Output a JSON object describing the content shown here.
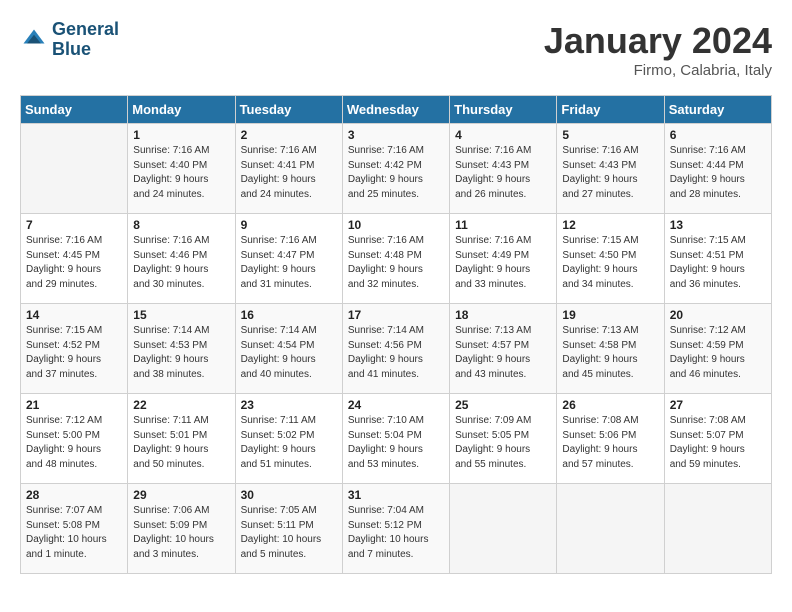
{
  "header": {
    "logo_line1": "General",
    "logo_line2": "Blue",
    "month": "January 2024",
    "location": "Firmo, Calabria, Italy"
  },
  "days_of_week": [
    "Sunday",
    "Monday",
    "Tuesday",
    "Wednesday",
    "Thursday",
    "Friday",
    "Saturday"
  ],
  "weeks": [
    [
      {
        "day": "",
        "info": ""
      },
      {
        "day": "1",
        "info": "Sunrise: 7:16 AM\nSunset: 4:40 PM\nDaylight: 9 hours\nand 24 minutes."
      },
      {
        "day": "2",
        "info": "Sunrise: 7:16 AM\nSunset: 4:41 PM\nDaylight: 9 hours\nand 24 minutes."
      },
      {
        "day": "3",
        "info": "Sunrise: 7:16 AM\nSunset: 4:42 PM\nDaylight: 9 hours\nand 25 minutes."
      },
      {
        "day": "4",
        "info": "Sunrise: 7:16 AM\nSunset: 4:43 PM\nDaylight: 9 hours\nand 26 minutes."
      },
      {
        "day": "5",
        "info": "Sunrise: 7:16 AM\nSunset: 4:43 PM\nDaylight: 9 hours\nand 27 minutes."
      },
      {
        "day": "6",
        "info": "Sunrise: 7:16 AM\nSunset: 4:44 PM\nDaylight: 9 hours\nand 28 minutes."
      }
    ],
    [
      {
        "day": "7",
        "info": "Sunrise: 7:16 AM\nSunset: 4:45 PM\nDaylight: 9 hours\nand 29 minutes."
      },
      {
        "day": "8",
        "info": "Sunrise: 7:16 AM\nSunset: 4:46 PM\nDaylight: 9 hours\nand 30 minutes."
      },
      {
        "day": "9",
        "info": "Sunrise: 7:16 AM\nSunset: 4:47 PM\nDaylight: 9 hours\nand 31 minutes."
      },
      {
        "day": "10",
        "info": "Sunrise: 7:16 AM\nSunset: 4:48 PM\nDaylight: 9 hours\nand 32 minutes."
      },
      {
        "day": "11",
        "info": "Sunrise: 7:16 AM\nSunset: 4:49 PM\nDaylight: 9 hours\nand 33 minutes."
      },
      {
        "day": "12",
        "info": "Sunrise: 7:15 AM\nSunset: 4:50 PM\nDaylight: 9 hours\nand 34 minutes."
      },
      {
        "day": "13",
        "info": "Sunrise: 7:15 AM\nSunset: 4:51 PM\nDaylight: 9 hours\nand 36 minutes."
      }
    ],
    [
      {
        "day": "14",
        "info": "Sunrise: 7:15 AM\nSunset: 4:52 PM\nDaylight: 9 hours\nand 37 minutes."
      },
      {
        "day": "15",
        "info": "Sunrise: 7:14 AM\nSunset: 4:53 PM\nDaylight: 9 hours\nand 38 minutes."
      },
      {
        "day": "16",
        "info": "Sunrise: 7:14 AM\nSunset: 4:54 PM\nDaylight: 9 hours\nand 40 minutes."
      },
      {
        "day": "17",
        "info": "Sunrise: 7:14 AM\nSunset: 4:56 PM\nDaylight: 9 hours\nand 41 minutes."
      },
      {
        "day": "18",
        "info": "Sunrise: 7:13 AM\nSunset: 4:57 PM\nDaylight: 9 hours\nand 43 minutes."
      },
      {
        "day": "19",
        "info": "Sunrise: 7:13 AM\nSunset: 4:58 PM\nDaylight: 9 hours\nand 45 minutes."
      },
      {
        "day": "20",
        "info": "Sunrise: 7:12 AM\nSunset: 4:59 PM\nDaylight: 9 hours\nand 46 minutes."
      }
    ],
    [
      {
        "day": "21",
        "info": "Sunrise: 7:12 AM\nSunset: 5:00 PM\nDaylight: 9 hours\nand 48 minutes."
      },
      {
        "day": "22",
        "info": "Sunrise: 7:11 AM\nSunset: 5:01 PM\nDaylight: 9 hours\nand 50 minutes."
      },
      {
        "day": "23",
        "info": "Sunrise: 7:11 AM\nSunset: 5:02 PM\nDaylight: 9 hours\nand 51 minutes."
      },
      {
        "day": "24",
        "info": "Sunrise: 7:10 AM\nSunset: 5:04 PM\nDaylight: 9 hours\nand 53 minutes."
      },
      {
        "day": "25",
        "info": "Sunrise: 7:09 AM\nSunset: 5:05 PM\nDaylight: 9 hours\nand 55 minutes."
      },
      {
        "day": "26",
        "info": "Sunrise: 7:08 AM\nSunset: 5:06 PM\nDaylight: 9 hours\nand 57 minutes."
      },
      {
        "day": "27",
        "info": "Sunrise: 7:08 AM\nSunset: 5:07 PM\nDaylight: 9 hours\nand 59 minutes."
      }
    ],
    [
      {
        "day": "28",
        "info": "Sunrise: 7:07 AM\nSunset: 5:08 PM\nDaylight: 10 hours\nand 1 minute."
      },
      {
        "day": "29",
        "info": "Sunrise: 7:06 AM\nSunset: 5:09 PM\nDaylight: 10 hours\nand 3 minutes."
      },
      {
        "day": "30",
        "info": "Sunrise: 7:05 AM\nSunset: 5:11 PM\nDaylight: 10 hours\nand 5 minutes."
      },
      {
        "day": "31",
        "info": "Sunrise: 7:04 AM\nSunset: 5:12 PM\nDaylight: 10 hours\nand 7 minutes."
      },
      {
        "day": "",
        "info": ""
      },
      {
        "day": "",
        "info": ""
      },
      {
        "day": "",
        "info": ""
      }
    ]
  ]
}
